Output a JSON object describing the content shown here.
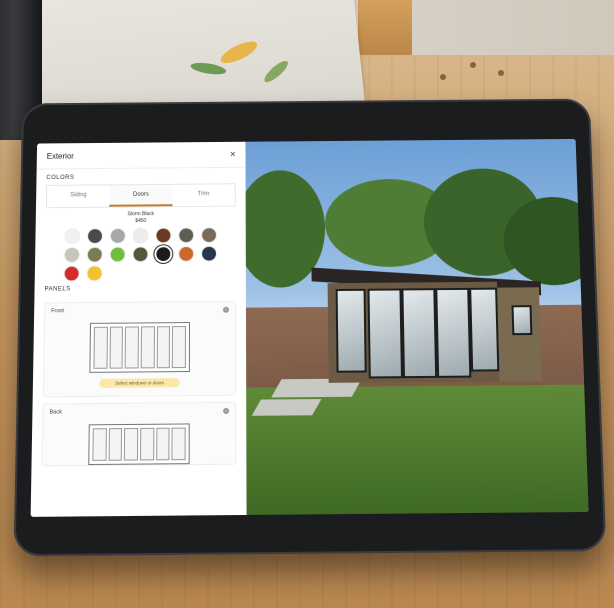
{
  "panel": {
    "title": "Exterior",
    "close_label": "×",
    "section_colors": "COLORS",
    "tabs": [
      {
        "label": "Siding",
        "active": false
      },
      {
        "label": "Doors",
        "active": true
      },
      {
        "label": "Trim",
        "active": false
      }
    ],
    "selected_color_name": "Storm Black",
    "selected_color_price": "$450",
    "swatches": [
      "#f1f1f1",
      "#4a4a4a",
      "#a7a7a7",
      "#ececec",
      "#6a3a22",
      "#5e5e52",
      "#7a6a5a",
      "#c9c5bd",
      "#7c7a55",
      "#6fbe3e",
      "#4f5a3a",
      "#1b1b1b",
      "#c96a2c",
      "#2a3550",
      "#d42b2b",
      "#f2c12e"
    ],
    "selected_swatch_index": 11,
    "section_panels": "PANELS",
    "front_card": {
      "title": "Front",
      "hint": "Select windows or doors"
    },
    "back_card": {
      "title": "Back"
    }
  },
  "colors": {
    "accent": "#c57a2c"
  }
}
